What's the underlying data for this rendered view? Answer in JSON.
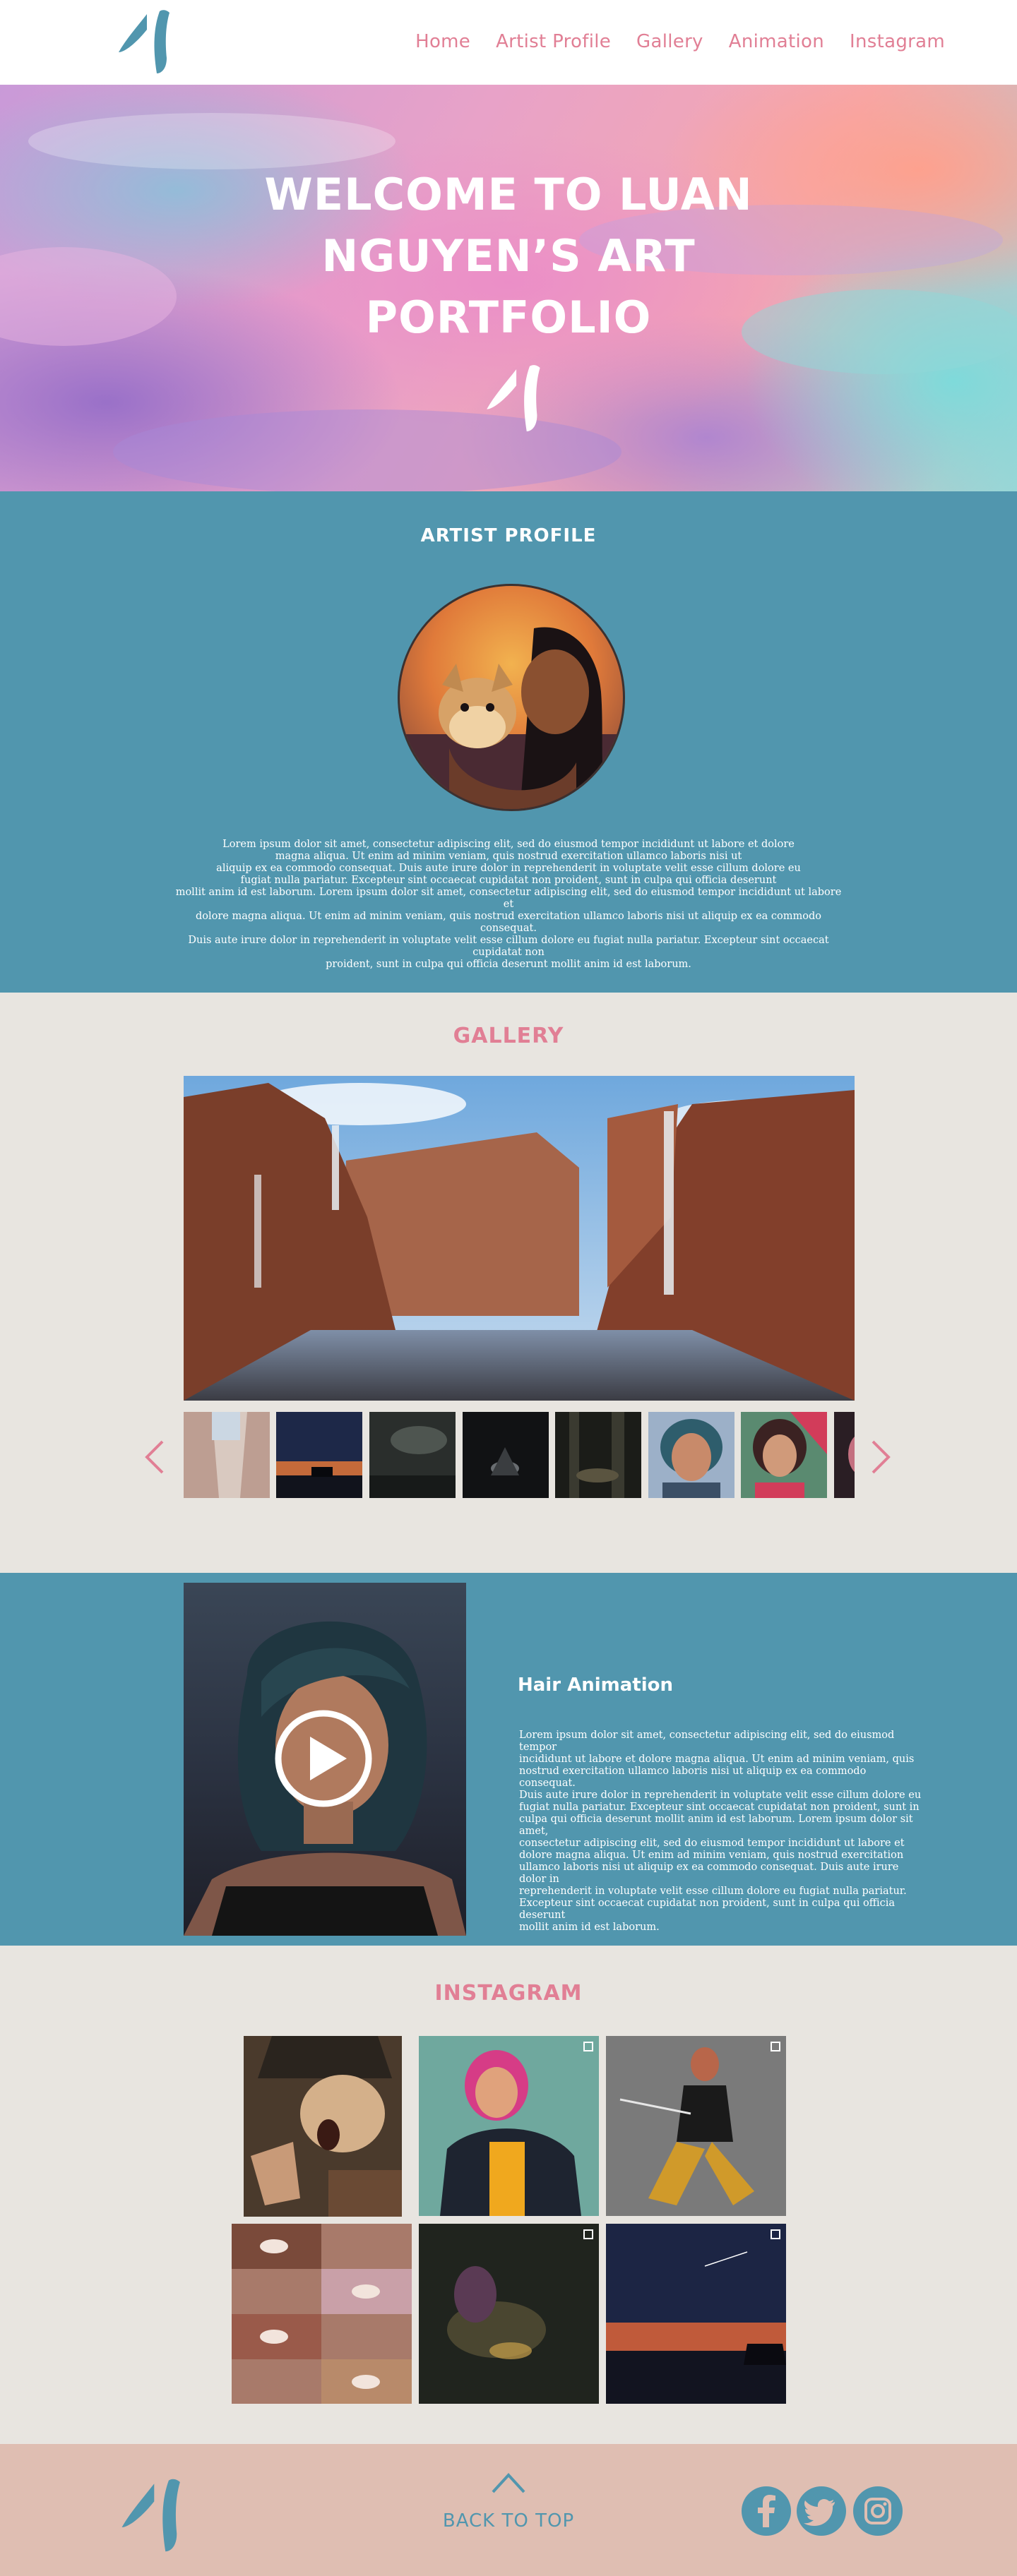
{
  "colors": {
    "accent_pink": "#e17f95",
    "teal": "#5196ae",
    "footer": "#dfbeb2",
    "background": "#e8e5e0"
  },
  "header": {
    "logo_icon": "brush-stroke-logo",
    "nav": [
      "Home",
      "Artist Profile",
      "Gallery",
      "Animation",
      "Instagram"
    ]
  },
  "hero": {
    "title_lines": [
      "WELCOME TO LUAN",
      "NGUYEN’S ART",
      "PORTFOLIO"
    ],
    "logo_icon": "brush-stroke-logo"
  },
  "profile": {
    "heading": "ARTIST PROFILE",
    "text_lines": [
      "Lorem ipsum dolor sit amet, consectetur adipiscing elit, sed do eiusmod tempor incididunt ut labore et dolore",
      "magna aliqua. Ut enim ad minim veniam, quis nostrud exercitation ullamco laboris nisi ut",
      "aliquip ex ea commodo consequat. Duis aute irure dolor in reprehenderit in voluptate velit esse cillum dolore eu",
      "fugiat nulla pariatur. Excepteur sint occaecat cupidatat non proident, sunt in culpa qui officia deserunt",
      "mollit anim id est laborum. Lorem ipsum dolor sit amet, consectetur adipiscing elit, sed do eiusmod tempor incididunt ut labore et",
      "dolore magna aliqua. Ut enim ad minim veniam, quis nostrud exercitation ullamco laboris nisi ut aliquip ex ea commodo consequat.",
      "Duis aute irure dolor in reprehenderit in voluptate velit esse cillum dolore eu fugiat nulla pariatur. Excepteur sint occaecat cupidatat non",
      "proident, sunt in culpa qui officia deserunt mollit anim id est laborum."
    ]
  },
  "gallery": {
    "heading": "GALLERY",
    "prev_icon": "chevron-left-icon",
    "next_icon": "chevron-right-icon",
    "thumbnail_count_visible": 8
  },
  "animation": {
    "title": "Hair Animation",
    "play_icon": "play-icon",
    "text_lines": [
      "Lorem ipsum dolor sit amet, consectetur adipiscing elit, sed do eiusmod tempor",
      "incididunt ut labore et dolore magna aliqua. Ut enim ad minim veniam, quis",
      "nostrud exercitation ullamco laboris nisi ut aliquip ex ea commodo consequat.",
      "Duis aute irure dolor in reprehenderit in voluptate velit esse cillum dolore eu",
      "fugiat nulla pariatur. Excepteur sint occaecat cupidatat non proident, sunt in",
      "culpa qui officia deserunt mollit anim id est laborum. Lorem ipsum dolor sit amet,",
      "consectetur adipiscing elit, sed do eiusmod tempor incididunt ut labore et",
      "dolore magna aliqua. Ut enim ad minim veniam, quis nostrud exercitation",
      "ullamco laboris nisi ut aliquip ex ea commodo consequat. Duis aute irure dolor in",
      "reprehenderit in voluptate velit esse cillum dolore eu fugiat nulla pariatur.",
      "Excepteur sint occaecat cupidatat non proident, sunt in culpa qui officia deserunt",
      "mollit anim id est laborum."
    ]
  },
  "instagram": {
    "heading": "INSTAGRAM",
    "multi_image_icon": "multiple-images-icon"
  },
  "footer": {
    "logo_icon": "brush-stroke-logo",
    "back_to_top": "BACK TO TOP",
    "back_to_top_icon": "chevron-up-icon",
    "social_icons": [
      "facebook-icon",
      "twitter-icon",
      "instagram-icon"
    ]
  }
}
